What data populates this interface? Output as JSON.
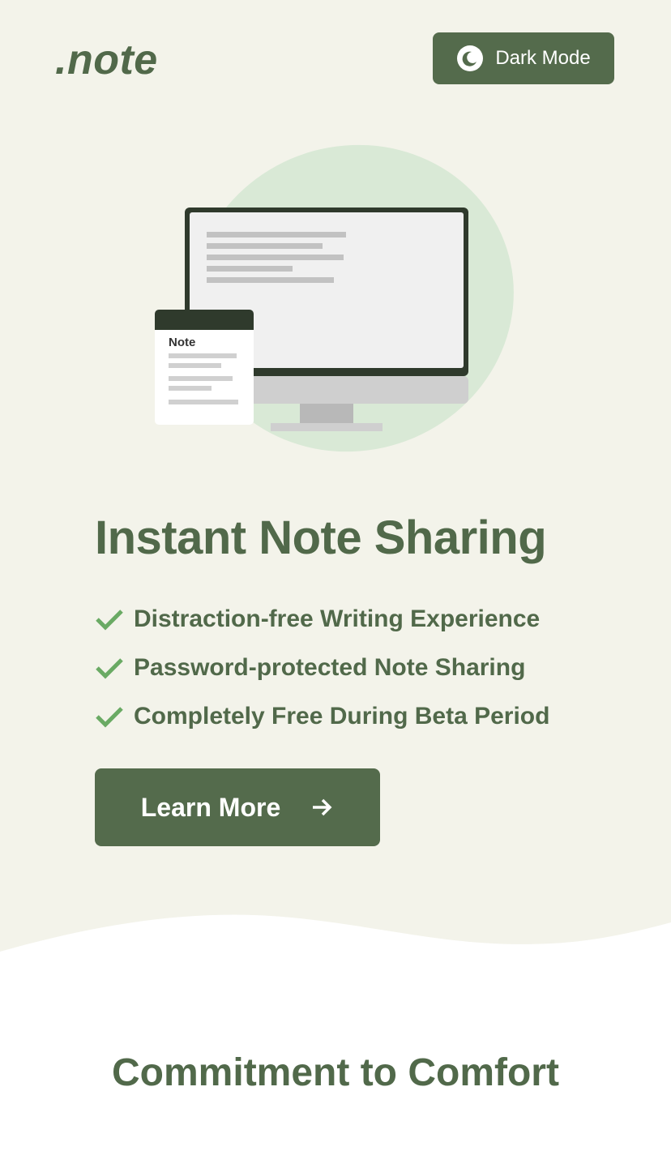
{
  "header": {
    "logo": ".note",
    "dark_mode_label": "Dark Mode",
    "dark_mode_icon": "moon-icon"
  },
  "illustration": {
    "note_card_title": "Note"
  },
  "hero": {
    "title": "Instant Note Sharing",
    "features": [
      "Distraction-free Writing Experience",
      "Password-protected Note Sharing",
      "Completely Free During Beta Period"
    ],
    "feature_icon": "check-icon",
    "cta_label": "Learn More",
    "cta_icon": "arrow-right-icon"
  },
  "section": {
    "title": "Commitment to Comfort"
  },
  "colors": {
    "brand": "#546b4c",
    "text": "#51694a",
    "hero_bg": "#f3f3ea",
    "check": "#6aaa64",
    "blob": "#d9e9d6"
  }
}
